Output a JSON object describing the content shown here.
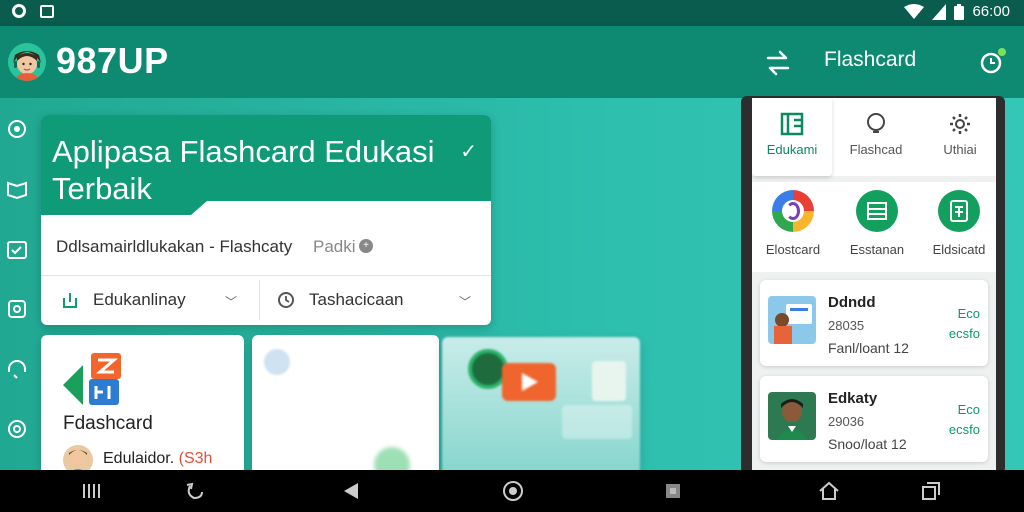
{
  "status_bar": {
    "time": "66:00",
    "left_icons": [
      "circle-notification-icon",
      "box-notification-icon"
    ],
    "right_icons": [
      "wifi-icon",
      "signal-icon",
      "battery-icon"
    ]
  },
  "app_bar": {
    "brand": "987UP",
    "title": "Flashcard",
    "icons": [
      "swap-icon",
      "clock-icon"
    ]
  },
  "side_rail": {
    "icons": [
      "target-icon",
      "book-icon",
      "calendar-icon",
      "camera-icon",
      "headset-icon",
      "record-icon"
    ]
  },
  "hero_card": {
    "title": "Aplipasa Flashcard Edukasi Terbaik",
    "subtitle": "Ddlsamairldlukakan - Flashcaty",
    "subtitle_tag": "Padki",
    "dropdowns": [
      {
        "label": "Edukanlinay",
        "icon": "export-icon"
      },
      {
        "label": "Tashacicaan",
        "icon": "clock-icon"
      }
    ]
  },
  "card_app": {
    "title": "Fdashcard",
    "user_name": "Edulaidor.",
    "user_number": "(S3h"
  },
  "phone": {
    "tabs": [
      {
        "label": "Edukami",
        "icon": "book-grid-icon",
        "active": true
      },
      {
        "label": "Flashcad",
        "icon": "bulb-icon",
        "active": false
      },
      {
        "label": "Uthiai",
        "icon": "gear-icon",
        "active": false
      }
    ],
    "shortcuts": [
      {
        "label": "Elostcard",
        "icon": "colorful-logo-icon"
      },
      {
        "label": "Esstanan",
        "icon": "table-icon"
      },
      {
        "label": "Eldsicatd",
        "icon": "document-icon"
      }
    ],
    "items": [
      {
        "name": "Ddndd",
        "id": "28035",
        "meta": "Fanl/loant 12",
        "price_line1": "Eco",
        "price_line2": "ecsfo"
      },
      {
        "name": "Edkaty",
        "id": "29036",
        "meta": "Snoo/loat 12",
        "price_line1": "Eco",
        "price_line2": "ecsfo"
      }
    ]
  },
  "nav_bar": {
    "icons": [
      "recents-icon",
      "back-curve-icon",
      "back-triangle-icon",
      "home-circle-icon",
      "square-stop-icon",
      "home-house-icon",
      "copy-icon"
    ]
  },
  "colors": {
    "primary": "#0f8a72",
    "status_bar": "#0a5c4e",
    "accent_green": "#0b9a6a",
    "accent_orange": "#e2503a"
  }
}
